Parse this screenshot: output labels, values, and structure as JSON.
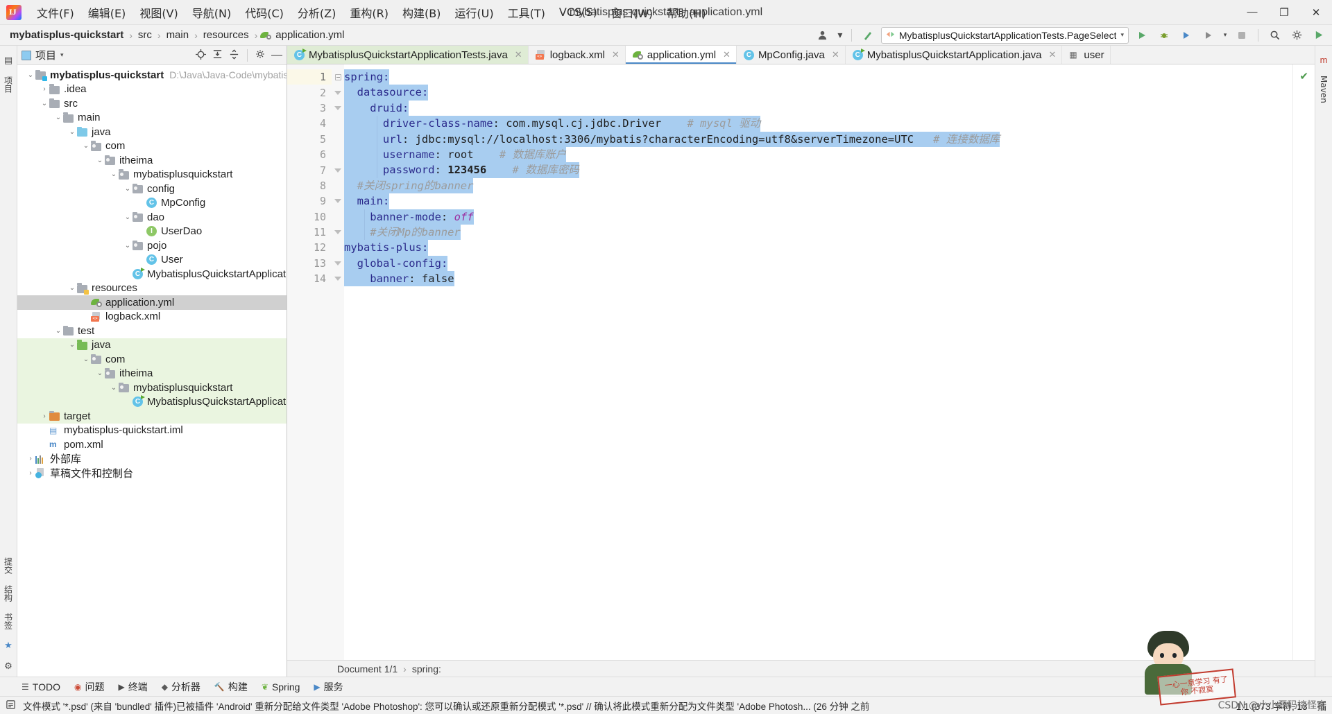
{
  "window": {
    "title": "mybatisplus-quickstart - application.yml",
    "minimize": "—",
    "maximize": "❐",
    "close": "✕"
  },
  "menubar": {
    "logo_text": "IJ",
    "items": [
      {
        "label": "文件(F)"
      },
      {
        "label": "编辑(E)"
      },
      {
        "label": "视图(V)"
      },
      {
        "label": "导航(N)"
      },
      {
        "label": "代码(C)"
      },
      {
        "label": "分析(Z)"
      },
      {
        "label": "重构(R)"
      },
      {
        "label": "构建(B)"
      },
      {
        "label": "运行(U)"
      },
      {
        "label": "工具(T)"
      },
      {
        "label": "VCS(S)"
      },
      {
        "label": "窗口(W)"
      },
      {
        "label": "帮助(H)"
      }
    ]
  },
  "navbar": {
    "breadcrumbs": [
      {
        "label": "mybatisplus-quickstart",
        "bold": true
      },
      {
        "label": "src",
        "bold": false
      },
      {
        "label": "main",
        "bold": false
      },
      {
        "label": "resources",
        "bold": false
      },
      {
        "label": "application.yml",
        "bold": false
      }
    ],
    "separator": "›",
    "run_config": "MybatisplusQuickstartApplicationTests.PageSelect",
    "icons": {
      "user": "user-icon",
      "hammer": "build-icon",
      "run": "run-icon",
      "debug": "debug-icon",
      "coverage": "coverage-icon",
      "profile": "profile-icon",
      "stop": "stop-icon",
      "search": "search-icon",
      "settings": "gear-icon",
      "updates": "updates-icon"
    }
  },
  "left_strip": {
    "items": [
      {
        "label": "项目"
      },
      {
        "label": "提交"
      },
      {
        "label": "结构"
      },
      {
        "label": "书签"
      }
    ]
  },
  "right_strip": {
    "items": [
      {
        "label": "Maven"
      }
    ]
  },
  "project_panel": {
    "title": "项目",
    "toolbar_icons": [
      "locate-icon",
      "expand-all-icon",
      "collapse-all-icon",
      "gear-icon",
      "hide-icon"
    ],
    "tree": [
      {
        "depth": 0,
        "arrow": "⌄",
        "icon": "folder-module",
        "label": "mybatisplus-quickstart",
        "bold": true,
        "path": "D:\\Java\\Java-Code\\mybatisplus-qu",
        "state": "none"
      },
      {
        "depth": 1,
        "arrow": "›",
        "icon": "folder",
        "label": ".idea",
        "bold": false,
        "path": "",
        "state": "none"
      },
      {
        "depth": 1,
        "arrow": "⌄",
        "icon": "folder",
        "label": "src",
        "bold": false,
        "path": "",
        "state": "none"
      },
      {
        "depth": 2,
        "arrow": "⌄",
        "icon": "folder",
        "label": "main",
        "bold": false,
        "path": "",
        "state": "none"
      },
      {
        "depth": 3,
        "arrow": "⌄",
        "icon": "folder-source",
        "label": "java",
        "bold": false,
        "path": "",
        "state": "none"
      },
      {
        "depth": 4,
        "arrow": "⌄",
        "icon": "folder-package",
        "label": "com",
        "bold": false,
        "path": "",
        "state": "none"
      },
      {
        "depth": 5,
        "arrow": "⌄",
        "icon": "folder-package",
        "label": "itheima",
        "bold": false,
        "path": "",
        "state": "none"
      },
      {
        "depth": 6,
        "arrow": "⌄",
        "icon": "folder-package",
        "label": "mybatisplusquickstart",
        "bold": false,
        "path": "",
        "state": "none"
      },
      {
        "depth": 7,
        "arrow": "⌄",
        "icon": "folder-package",
        "label": "config",
        "bold": false,
        "path": "",
        "state": "none"
      },
      {
        "depth": 8,
        "arrow": "",
        "icon": "class",
        "label": "MpConfig",
        "bold": false,
        "path": "",
        "state": "none"
      },
      {
        "depth": 7,
        "arrow": "⌄",
        "icon": "folder-package",
        "label": "dao",
        "bold": false,
        "path": "",
        "state": "none"
      },
      {
        "depth": 8,
        "arrow": "",
        "icon": "interface",
        "label": "UserDao",
        "bold": false,
        "path": "",
        "state": "none"
      },
      {
        "depth": 7,
        "arrow": "⌄",
        "icon": "folder-package",
        "label": "pojo",
        "bold": false,
        "path": "",
        "state": "none"
      },
      {
        "depth": 8,
        "arrow": "",
        "icon": "class",
        "label": "User",
        "bold": false,
        "path": "",
        "state": "none"
      },
      {
        "depth": 7,
        "arrow": "",
        "icon": "spring-class",
        "label": "MybatisplusQuickstartApplication",
        "bold": false,
        "path": "",
        "state": "none"
      },
      {
        "depth": 3,
        "arrow": "⌄",
        "icon": "folder-resources",
        "label": "resources",
        "bold": false,
        "path": "",
        "state": "none"
      },
      {
        "depth": 4,
        "arrow": "",
        "icon": "yaml",
        "label": "application.yml",
        "bold": false,
        "path": "",
        "state": "selected"
      },
      {
        "depth": 4,
        "arrow": "",
        "icon": "xml",
        "label": "logback.xml",
        "bold": false,
        "path": "",
        "state": "none"
      },
      {
        "depth": 2,
        "arrow": "⌄",
        "icon": "folder",
        "label": "test",
        "bold": false,
        "path": "",
        "state": "none"
      },
      {
        "depth": 3,
        "arrow": "⌄",
        "icon": "folder-test",
        "label": "java",
        "bold": false,
        "path": "",
        "state": "green"
      },
      {
        "depth": 4,
        "arrow": "⌄",
        "icon": "folder-package",
        "label": "com",
        "bold": false,
        "path": "",
        "state": "green"
      },
      {
        "depth": 5,
        "arrow": "⌄",
        "icon": "folder-package",
        "label": "itheima",
        "bold": false,
        "path": "",
        "state": "green"
      },
      {
        "depth": 6,
        "arrow": "⌄",
        "icon": "folder-package",
        "label": "mybatisplusquickstart",
        "bold": false,
        "path": "",
        "state": "green"
      },
      {
        "depth": 7,
        "arrow": "",
        "icon": "spring-class",
        "label": "MybatisplusQuickstartApplicationTes",
        "bold": false,
        "path": "",
        "state": "green"
      },
      {
        "depth": 1,
        "arrow": "›",
        "icon": "folder-target",
        "label": "target",
        "bold": false,
        "path": "",
        "state": "green"
      },
      {
        "depth": 1,
        "arrow": "",
        "icon": "iml",
        "label": "mybatisplus-quickstart.iml",
        "bold": false,
        "path": "",
        "state": "none"
      },
      {
        "depth": 1,
        "arrow": "",
        "icon": "maven",
        "label": "pom.xml",
        "bold": false,
        "path": "",
        "state": "none"
      },
      {
        "depth": 0,
        "arrow": "›",
        "icon": "library",
        "label": "外部库",
        "bold": false,
        "path": "",
        "state": "none"
      },
      {
        "depth": 0,
        "arrow": "›",
        "icon": "scratch",
        "label": "草稿文件和控制台",
        "bold": false,
        "path": "",
        "state": "none"
      }
    ]
  },
  "editor": {
    "tabs": [
      {
        "label": "MybatisplusQuickstartApplicationTests.java",
        "icon": "spring-class-icon",
        "state": "green"
      },
      {
        "label": "logback.xml",
        "icon": "xml-icon",
        "state": "normal"
      },
      {
        "label": "application.yml",
        "icon": "yaml-icon",
        "state": "active"
      },
      {
        "label": "MpConfig.java",
        "icon": "class-icon",
        "state": "normal"
      },
      {
        "label": "MybatisplusQuickstartApplication.java",
        "icon": "spring-class-icon",
        "state": "normal"
      },
      {
        "label": "user",
        "icon": "table-icon",
        "state": "normal"
      }
    ],
    "close_glyph": "✕",
    "gutter_lines": [
      "1",
      "2",
      "3",
      "4",
      "5",
      "6",
      "7",
      "8",
      "9",
      "10",
      "11",
      "12",
      "13",
      "14"
    ],
    "lines": [
      {
        "n": 1,
        "indent": 0,
        "segments": [
          {
            "t": "spring:",
            "c": "key"
          }
        ]
      },
      {
        "n": 2,
        "indent": 1,
        "segments": [
          {
            "t": "datasource:",
            "c": "key"
          }
        ]
      },
      {
        "n": 3,
        "indent": 2,
        "segments": [
          {
            "t": "druid:",
            "c": "key"
          }
        ]
      },
      {
        "n": 4,
        "indent": 3,
        "segments": [
          {
            "t": "driver-class-name",
            "c": "key"
          },
          {
            "t": ": ",
            "c": "val"
          },
          {
            "t": "com.mysql.cj.jdbc.Driver",
            "c": "val"
          },
          {
            "t": "    # mysql 驱动",
            "c": "cmt"
          }
        ]
      },
      {
        "n": 5,
        "indent": 3,
        "segments": [
          {
            "t": "url",
            "c": "key"
          },
          {
            "t": ": ",
            "c": "val"
          },
          {
            "t": "jdbc:mysql://localhost:3306/mybatis?characterEncoding=utf8&serverTimezone=UTC",
            "c": "val"
          },
          {
            "t": "   # 连接数据库",
            "c": "cmt"
          }
        ]
      },
      {
        "n": 6,
        "indent": 3,
        "segments": [
          {
            "t": "username",
            "c": "key"
          },
          {
            "t": ": ",
            "c": "val"
          },
          {
            "t": "root",
            "c": "val"
          },
          {
            "t": "    # 数据库账户",
            "c": "cmt"
          }
        ]
      },
      {
        "n": 7,
        "indent": 3,
        "segments": [
          {
            "t": "password",
            "c": "key"
          },
          {
            "t": ": ",
            "c": "val"
          },
          {
            "t": "123456",
            "c": "num"
          },
          {
            "t": "    # 数据库密码",
            "c": "cmt"
          }
        ]
      },
      {
        "n": 8,
        "indent": 1,
        "segments": [
          {
            "t": "#关闭spring的banner",
            "c": "cmt"
          }
        ]
      },
      {
        "n": 9,
        "indent": 1,
        "segments": [
          {
            "t": "main:",
            "c": "key"
          }
        ]
      },
      {
        "n": 10,
        "indent": 2,
        "segments": [
          {
            "t": "banner-mode",
            "c": "key"
          },
          {
            "t": ": ",
            "c": "val"
          },
          {
            "t": "off",
            "c": "italicv"
          }
        ]
      },
      {
        "n": 11,
        "indent": 2,
        "segments": [
          {
            "t": "#关闭Mp的banner",
            "c": "cmt"
          }
        ]
      },
      {
        "n": 12,
        "indent": 0,
        "segments": [
          {
            "t": "mybatis-plus:",
            "c": "key"
          }
        ]
      },
      {
        "n": 13,
        "indent": 1,
        "segments": [
          {
            "t": "global-config:",
            "c": "key"
          }
        ]
      },
      {
        "n": 14,
        "indent": 2,
        "segments": [
          {
            "t": "banner",
            "c": "key"
          },
          {
            "t": ": ",
            "c": "val"
          },
          {
            "t": "false",
            "c": "val"
          }
        ]
      }
    ],
    "inspection_status": "✔",
    "breadcrumb_bar": {
      "document": "Document 1/1",
      "separator": "›",
      "node": "spring:"
    }
  },
  "bottom_bar": {
    "items": [
      {
        "label": "TODO",
        "icon": "todo-icon"
      },
      {
        "label": "问题",
        "icon": "problems-icon"
      },
      {
        "label": "终端",
        "icon": "terminal-icon"
      },
      {
        "label": "分析器",
        "icon": "profiler-icon"
      },
      {
        "label": "构建",
        "icon": "build-icon"
      },
      {
        "label": "Spring",
        "icon": "spring-icon"
      },
      {
        "label": "服务",
        "icon": "services-icon"
      }
    ]
  },
  "statusbar": {
    "message": "文件模式 '*.psd' (来自 'bundled' 插件)已被插件 'Android' 重新分配给文件类型 'Adobe Photoshop': 您可以确认或还原重新分配模式 '*.psd' // 确认将此模式重新分配为文件类型 'Adobe Photosh... (26 分钟 之前",
    "caret_position": "1:1 (373 字符, 13",
    "extra": "插"
  },
  "watermarks": {
    "stamp_text": "一心一意学习\n有了你 不寂寞",
    "csdn": "CSDN @小小磊码搞怪客"
  }
}
